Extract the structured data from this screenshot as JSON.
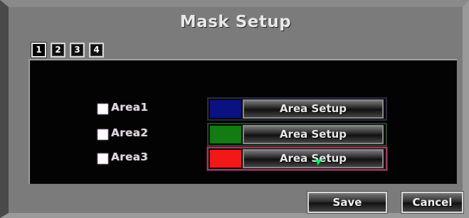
{
  "dialog": {
    "title": "Mask Setup"
  },
  "tabs": [
    {
      "label": "1",
      "active": true
    },
    {
      "label": "2",
      "active": false
    },
    {
      "label": "3",
      "active": false
    },
    {
      "label": "4",
      "active": false
    }
  ],
  "areas": [
    {
      "label": "Area1",
      "checked": false,
      "color": "#0a1180",
      "button_label": "Area Setup"
    },
    {
      "label": "Area2",
      "checked": false,
      "color": "#127b12",
      "button_label": "Area Setup"
    },
    {
      "label": "Area3",
      "checked": false,
      "color": "#f21818",
      "button_label": "Area Setup"
    }
  ],
  "actions": {
    "save": "Save",
    "cancel": "Cancel"
  },
  "icons": {
    "cursor": "mouse-pointer-icon"
  }
}
